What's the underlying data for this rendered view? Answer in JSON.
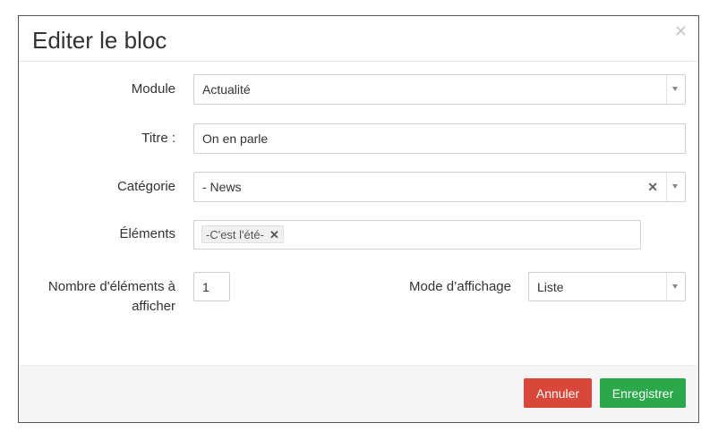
{
  "modal": {
    "title": "Editer le bloc",
    "close_icon": "close-icon"
  },
  "form": {
    "module": {
      "label": "Module",
      "value": "Actualité"
    },
    "titre": {
      "label": "Titre :",
      "value": "On en parle"
    },
    "categorie": {
      "label": "Catégorie",
      "value": "- News"
    },
    "elements": {
      "label": "Éléments",
      "tags": [
        "-C'est l'été-"
      ]
    },
    "nombre": {
      "label_line1": "Nombre d'éléments à",
      "label_line2": "afficher",
      "value": "1"
    },
    "mode": {
      "label": "Mode d’affichage",
      "value": "Liste"
    }
  },
  "footer": {
    "cancel_label": "Annuler",
    "save_label": "Enregistrer"
  },
  "colors": {
    "cancel": "#d9463a",
    "save": "#2aa84a"
  }
}
